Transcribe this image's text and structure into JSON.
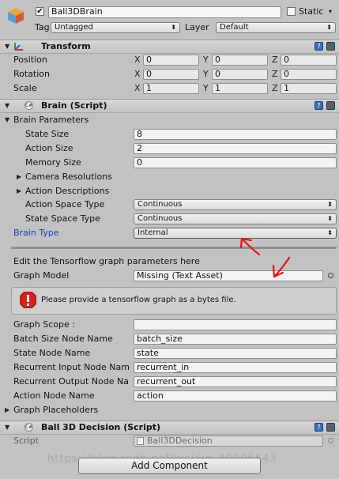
{
  "header": {
    "object_name": "Ball3DBrain",
    "static_label": "Static",
    "tag_label": "Tag",
    "tag_value": "Untagged",
    "layer_label": "Layer",
    "layer_value": "Default"
  },
  "transform": {
    "title": "Transform",
    "rows": [
      {
        "label": "Position",
        "x": "0",
        "y": "0",
        "z": "0"
      },
      {
        "label": "Rotation",
        "x": "0",
        "y": "0",
        "z": "0"
      },
      {
        "label": "Scale",
        "x": "1",
        "y": "1",
        "z": "1"
      }
    ],
    "axis_x": "X",
    "axis_y": "Y",
    "axis_z": "Z"
  },
  "brain": {
    "title": "Brain (Script)",
    "params_label": "Brain Parameters",
    "state_size_label": "State Size",
    "state_size": "8",
    "action_size_label": "Action Size",
    "action_size": "2",
    "memory_size_label": "Memory Size",
    "memory_size": "0",
    "camera_res_label": "Camera Resolutions",
    "action_desc_label": "Action Descriptions",
    "action_space_label": "Action Space Type",
    "action_space": "Continuous",
    "state_space_label": "State Space Type",
    "state_space": "Continuous",
    "brain_type_label": "Brain Type",
    "brain_type": "Internal",
    "edit_text": "Edit the Tensorflow graph parameters here",
    "graph_model_label": "Graph Model",
    "graph_model": "Missing (Text Asset)",
    "warning_text": "Please provide a tensorflow graph as a bytes file.",
    "graph_scope_label": "Graph Scope :",
    "graph_scope": "",
    "batch_size_label": "Batch Size Node Name",
    "batch_size": "batch_size",
    "state_node_label": "State Node Name",
    "state_node": "state",
    "rec_in_label": "Recurrent Input Node Nam",
    "rec_in": "recurrent_in",
    "rec_out_label": "Recurrent Output Node Na",
    "rec_out": "recurrent_out",
    "action_node_label": "Action Node Name",
    "action_node": "action",
    "placeholders_label": "Graph Placeholders"
  },
  "decision": {
    "title": "Ball 3D Decision (Script)",
    "script_label": "Script",
    "script_value": "Ball3DDecision"
  },
  "add_component": "Add Component",
  "watermark": "https://blog.csdn.net/weixin_40006543",
  "colors": {
    "panel": "#c2c2c2",
    "brain_type_label": "#1b3fb8",
    "annotation": "#e8131d",
    "warning": "#d42121"
  }
}
